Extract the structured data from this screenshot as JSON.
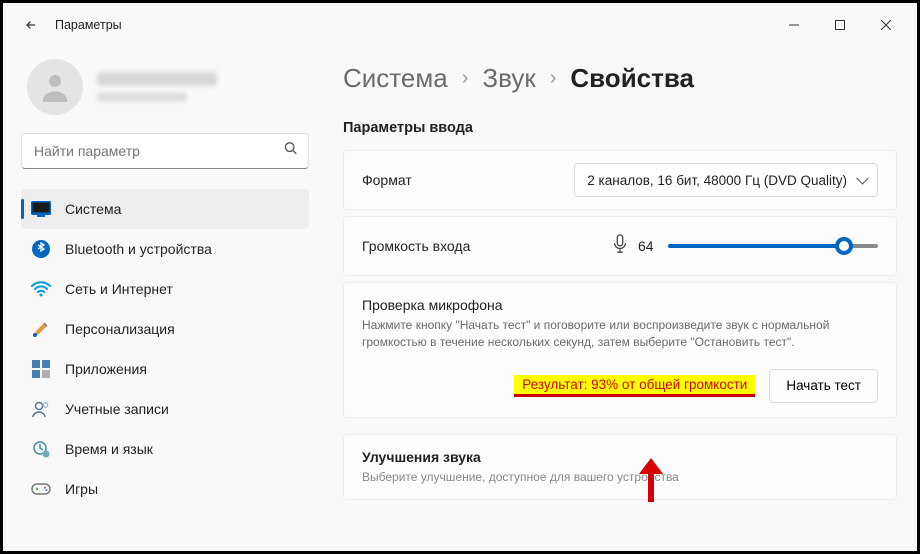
{
  "app_title": "Параметры",
  "search": {
    "placeholder": "Найти параметр"
  },
  "sidebar": {
    "items": [
      {
        "label": "Система"
      },
      {
        "label": "Bluetooth и устройства"
      },
      {
        "label": "Сеть и Интернет"
      },
      {
        "label": "Персонализация"
      },
      {
        "label": "Приложения"
      },
      {
        "label": "Учетные записи"
      },
      {
        "label": "Время и язык"
      },
      {
        "label": "Игры"
      }
    ]
  },
  "breadcrumb": {
    "l1": "Система",
    "l2": "Звук",
    "current": "Свойства"
  },
  "section": {
    "title": "Параметры ввода"
  },
  "format": {
    "label": "Формат",
    "value": "2 каналов, 16 бит, 48000 Гц (DVD Quality)"
  },
  "volume": {
    "label": "Громкость входа",
    "value": "64",
    "percent": 64
  },
  "mic_test": {
    "title": "Проверка микрофона",
    "hint": "Нажмите кнопку \"Начать тест\" и поговорите или воспроизведите звук с нормальной громкостью в течение нескольких секунд, затем выберите \"Остановить тест\".",
    "result": "Результат: 93% от общей громкости",
    "button": "Начать тест"
  },
  "enhance": {
    "title": "Улучшения звука",
    "hint": "Выберите улучшение, доступное для вашего устройства"
  }
}
